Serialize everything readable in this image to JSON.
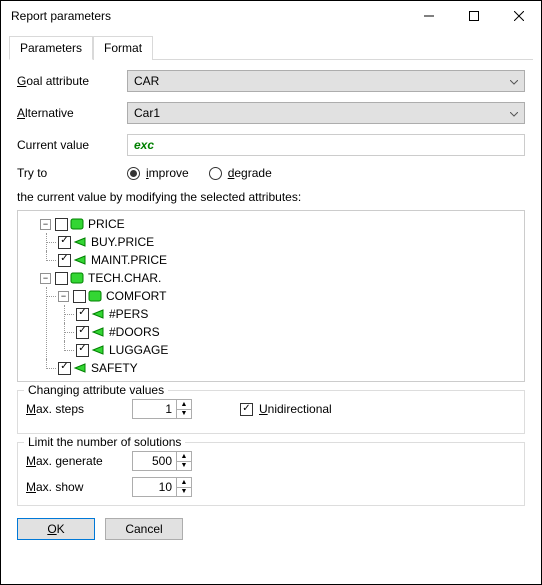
{
  "window": {
    "title": "Report parameters"
  },
  "tabs": {
    "parameters": "Parameters",
    "format": "Format"
  },
  "form": {
    "goal_label_prefix": "G",
    "goal_label_rest": "oal attribute",
    "goal_value": "CAR",
    "alt_label_prefix": "A",
    "alt_label_rest": "lternative",
    "alt_value": "Car1",
    "curval_label": "Current value",
    "curval_value": "exc",
    "tryto_label": "Try to",
    "radio_improve_prefix": "i",
    "radio_improve_rest": "mprove",
    "radio_degrade_prefix": "d",
    "radio_degrade_rest": "egrade"
  },
  "description": "the current value by modifying the selected attributes:",
  "tree": {
    "n0": "PRICE",
    "n0_0": "BUY.PRICE",
    "n0_1": "MAINT.PRICE",
    "n1": "TECH.CHAR.",
    "n1_0": "COMFORT",
    "n1_0_0": "#PERS",
    "n1_0_1": "#DOORS",
    "n1_0_2": "LUGGAGE",
    "n1_1": "SAFETY"
  },
  "changing": {
    "legend": "Changing attribute values",
    "maxsteps_pre": "M",
    "maxsteps_rest": "ax. steps",
    "maxsteps_val": "1",
    "uni_pre": "U",
    "uni_rest": "nidirectional"
  },
  "limit": {
    "legend": "Limit the number of solutions",
    "maxgen_pre": "M",
    "maxgen_rest": "ax. generate",
    "maxgen_val": "500",
    "maxshow_pre": "M",
    "maxshow_rest": "ax. show",
    "maxshow_val": "10"
  },
  "buttons": {
    "ok_pre": "O",
    "ok_rest": "K",
    "cancel": "Cancel"
  },
  "chart_data": null
}
